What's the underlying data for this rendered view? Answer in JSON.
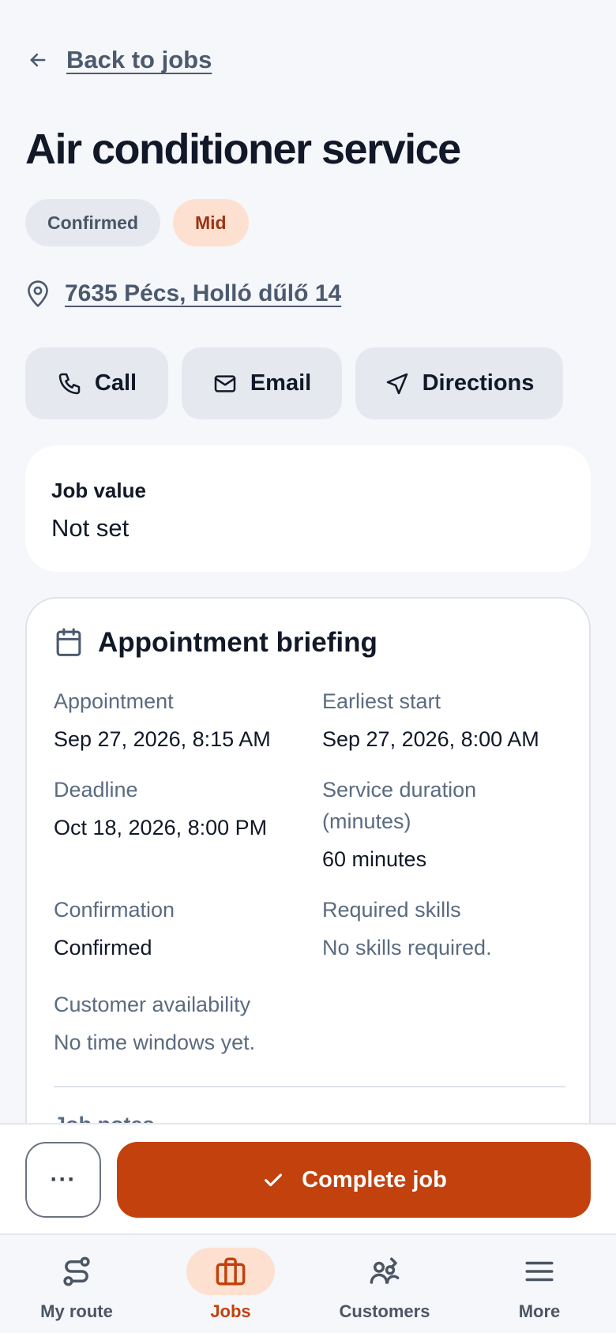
{
  "back": {
    "label": "Back to jobs",
    "icon": "arrow-left-icon"
  },
  "job": {
    "title": "Air conditioner service",
    "badges": [
      {
        "label": "Confirmed",
        "color": "#e5e9ef"
      },
      {
        "label": "Mid",
        "color": "#fde0cf"
      }
    ],
    "address": "7635 Pécs, Holló dűlő 14"
  },
  "actions": {
    "call": "Call",
    "email": "Email",
    "directions": "Directions"
  },
  "value_card": {
    "label": "Job value",
    "value": "Not set"
  },
  "briefing": {
    "title": "Appointment briefing",
    "fields": {
      "appointment": {
        "label": "Appointment",
        "value": "Sep 27, 2026, 8:15 AM"
      },
      "earliest_start": {
        "label": "Earliest start",
        "value": "Sep 27, 2026, 8:00 AM"
      },
      "deadline": {
        "label": "Deadline",
        "value": "Oct 18, 2026, 8:00 PM"
      },
      "service_duration": {
        "label": "Service duration (minutes)",
        "value": "60 minutes"
      },
      "confirmation": {
        "label": "Confirmation",
        "value": "Confirmed"
      },
      "required_skills": {
        "label": "Required skills",
        "value": "No skills required."
      },
      "customer_availability": {
        "label": "Customer availability",
        "value": "No time windows yet."
      }
    },
    "notes_heading": "Job notes"
  },
  "footer": {
    "more_label": "···",
    "complete_label": "Complete job"
  },
  "nav": {
    "items": [
      {
        "label": "My route",
        "icon": "route-icon"
      },
      {
        "label": "Jobs",
        "icon": "briefcase-icon",
        "active": true
      },
      {
        "label": "Customers",
        "icon": "customers-icon"
      },
      {
        "label": "More",
        "icon": "menu-icon"
      }
    ]
  },
  "colors": {
    "accent": "#c2410c",
    "accent_soft": "#fde0cf",
    "chip": "#e5e9ef",
    "muted_text": "#5b6b80"
  }
}
